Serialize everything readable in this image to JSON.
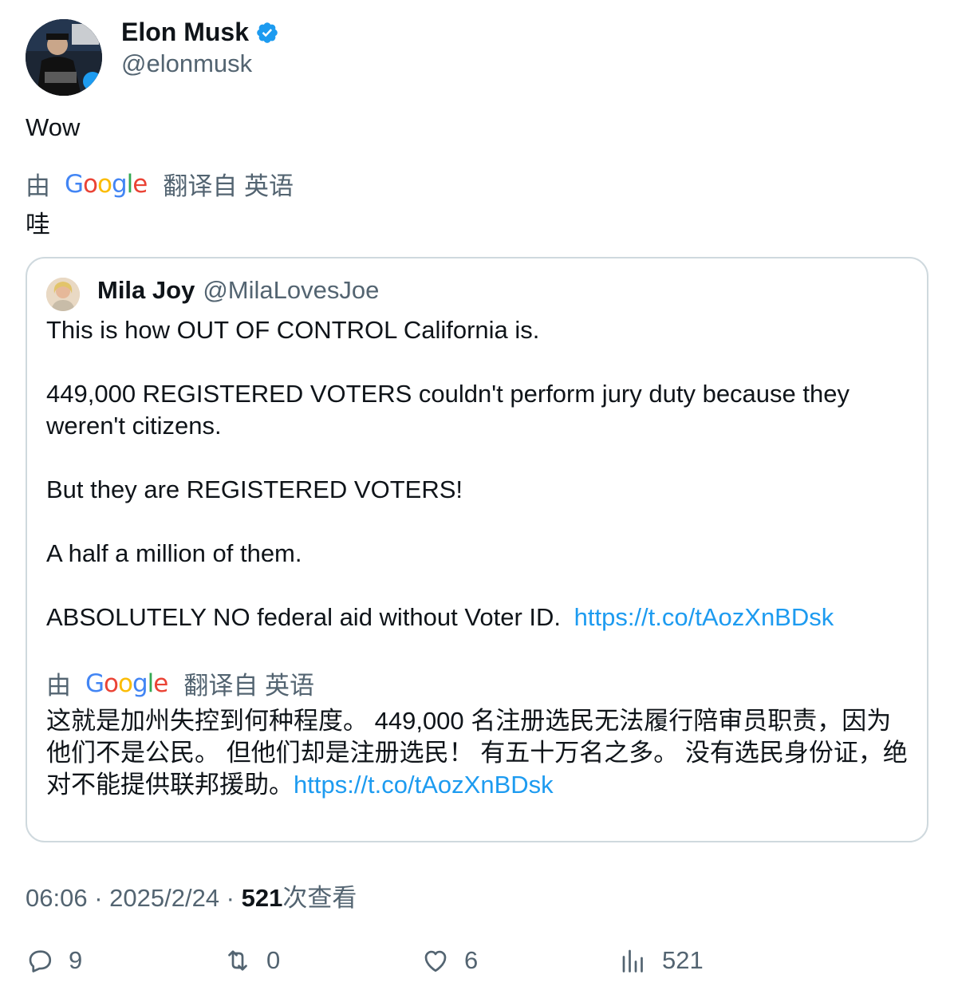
{
  "author": {
    "name": "Elon Musk",
    "handle": "@elonmusk"
  },
  "tweet": {
    "text": "Wow",
    "translation": {
      "by_label": "由",
      "google_label": "Google",
      "from_label": "翻译自 英语",
      "text": "哇"
    }
  },
  "quote": {
    "author_name": "Mila Joy",
    "author_handle": "@MilaLovesJoe",
    "lines": [
      "This is how OUT OF CONTROL California is.",
      "449,000 REGISTERED VOTERS couldn't perform jury duty because they weren't citizens.",
      "But they are REGISTERED VOTERS!",
      "A half a million of them.",
      "ABSOLUTELY NO federal aid without Voter ID. "
    ],
    "link": "https://t.co/tAozXnBDsk",
    "translation": {
      "by_label": "由",
      "google_label": "Google",
      "from_label": "翻译自 英语",
      "text": "这就是加州失控到何种程度。 449,000 名注册选民无法履行陪审员职责，因为他们不是公民。 但他们却是注册选民！ 有五十万名之多。 没有选民身份证，绝对不能提供联邦援助。",
      "link": "https://t.co/tAozXnBDsk"
    }
  },
  "meta": {
    "time": "06:06",
    "separator": " · ",
    "date": "2025/2/24",
    "views_count": "521",
    "views_label": "次查看"
  },
  "actions": {
    "replies": "9",
    "reposts": "0",
    "likes": "6",
    "views": "521"
  },
  "colors": {
    "link": "#1d9bf0",
    "verified": "#1d9bf0",
    "secondary_text": "#536471"
  },
  "icons": [
    "verified-badge-icon",
    "google-logo",
    "reply-icon",
    "repost-icon",
    "like-icon",
    "views-icon"
  ]
}
